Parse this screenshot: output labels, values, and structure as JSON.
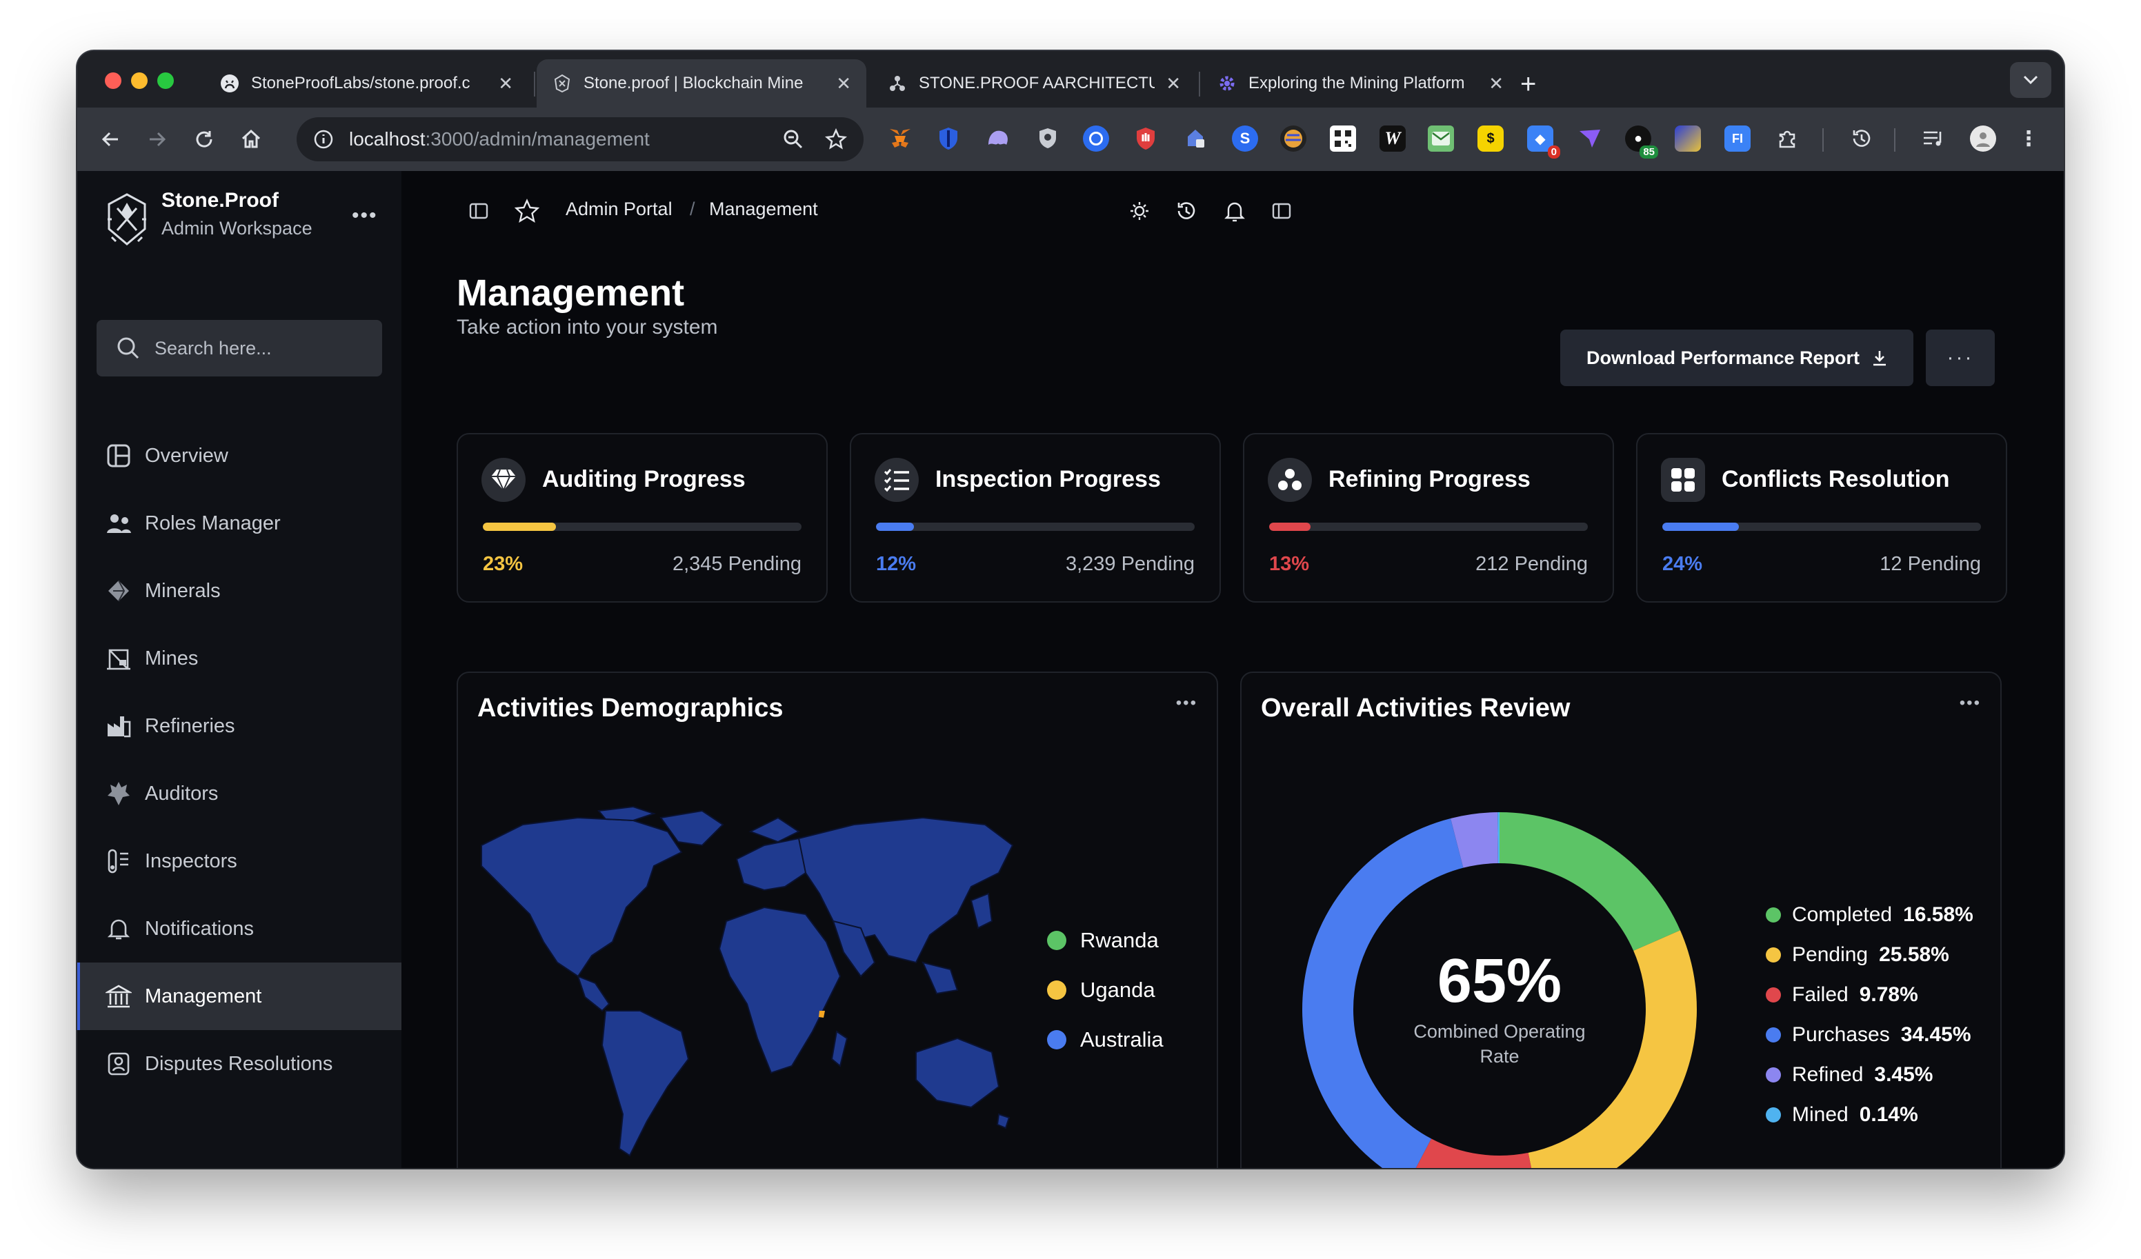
{
  "browser": {
    "tabs": [
      {
        "title": "StoneProofLabs/stone.proof.c",
        "active": false,
        "favicon": "github-icon"
      },
      {
        "title": "Stone.proof | Blockchain Mine",
        "active": true,
        "favicon": "stoneproof-icon"
      },
      {
        "title": "STONE.PROOF AARCHITECTU",
        "active": false,
        "favicon": "diagram-icon"
      },
      {
        "title": "Exploring the Mining Platform",
        "active": false,
        "favicon": "gear-icon"
      }
    ],
    "url_host": "localhost",
    "url_path": ":3000/admin/management",
    "extension_badges": {
      "red": "0",
      "green": "85"
    },
    "colors": {
      "chrome_dark": "#1f2126",
      "chrome_light": "#34373e"
    }
  },
  "sidebar": {
    "brand_name": "Stone.Proof",
    "brand_sub": "Admin Workspace",
    "search_placeholder": "Search here...",
    "items": [
      {
        "label": "Overview",
        "icon": "overview-icon"
      },
      {
        "label": "Roles Manager",
        "icon": "users-icon"
      },
      {
        "label": "Minerals",
        "icon": "gem-icon"
      },
      {
        "label": "Mines",
        "icon": "mine-icon"
      },
      {
        "label": "Refineries",
        "icon": "factory-icon"
      },
      {
        "label": "Auditors",
        "icon": "auditor-icon"
      },
      {
        "label": "Inspectors",
        "icon": "inspector-icon"
      },
      {
        "label": "Notifications",
        "icon": "bell-icon"
      },
      {
        "label": "Management",
        "icon": "bank-icon",
        "active": true
      },
      {
        "label": "Disputes Resolutions",
        "icon": "contact-icon"
      }
    ]
  },
  "header": {
    "breadcrumb": [
      "Admin Portal",
      "Management"
    ],
    "breadcrumb_sep": "/"
  },
  "page": {
    "title": "Management",
    "subtitle": "Take action into your system",
    "download_label": "Download Performance Report",
    "more_label": "···"
  },
  "cards": [
    {
      "title": "Auditing Progress",
      "percent": "23%",
      "progress": 0.23,
      "pending": "2,345 Pending",
      "color": "#f5c542",
      "icon": "diamond-icon"
    },
    {
      "title": "Inspection Progress",
      "percent": "12%",
      "progress": 0.12,
      "pending": "3,239 Pending",
      "color": "#4a7cf0",
      "icon": "checklist-icon"
    },
    {
      "title": "Refining Progress",
      "percent": "13%",
      "progress": 0.13,
      "pending": "212 Pending",
      "color": "#e0474c",
      "icon": "cluster-icon"
    },
    {
      "title": "Conflicts Resolution",
      "percent": "24%",
      "progress": 0.24,
      "pending": "12 Pending",
      "color": "#4a7cf0",
      "icon": "grid-icon"
    }
  ],
  "demographics": {
    "title": "Activities Demographics",
    "legend": [
      {
        "label": "Rwanda",
        "color": "#5cc466"
      },
      {
        "label": "Uganda",
        "color": "#f5c542"
      },
      {
        "label": "Australia",
        "color": "#4a7cf0"
      }
    ],
    "map_color": "#1f3a8f"
  },
  "review": {
    "title": "Overall Activities Review",
    "center_value": "65%",
    "center_label": "Combined Operating Rate"
  },
  "chart_data": {
    "type": "pie",
    "title": "Overall Activities Review",
    "categories": [
      "Completed",
      "Pending",
      "Failed",
      "Purchases",
      "Refined",
      "Mined"
    ],
    "values": [
      16.58,
      25.58,
      9.78,
      34.45,
      3.45,
      0.14
    ],
    "labels": [
      "16.58%",
      "25.58%",
      "9.78%",
      "34.45%",
      "3.45%",
      "0.14%"
    ],
    "colors": [
      "#5cc466",
      "#f5c542",
      "#e0474c",
      "#4a7cf0",
      "#8c86f0",
      "#4fb3f0"
    ],
    "legend_position": "right"
  }
}
